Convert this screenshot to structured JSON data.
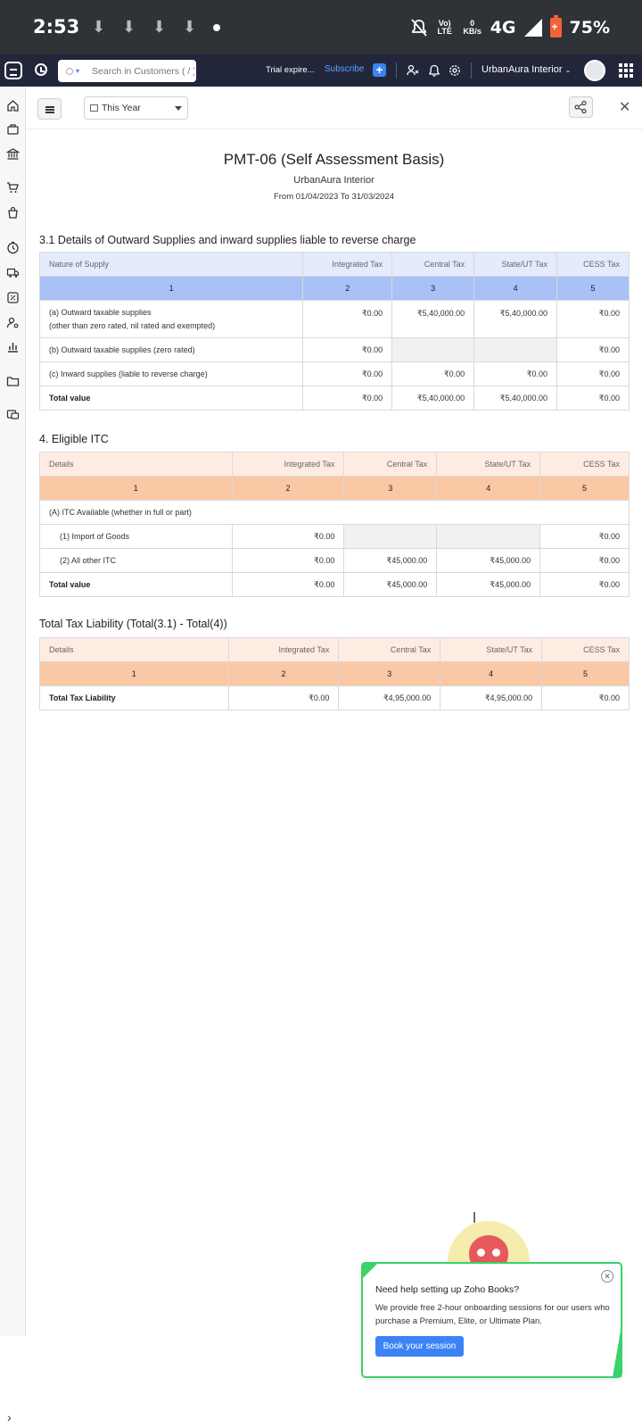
{
  "status_bar": {
    "time": "2:53",
    "network": "4G",
    "volte": "Vo) LTE",
    "speed": "0 KB/s",
    "battery": "75%"
  },
  "app_bar": {
    "search_placeholder": "Search in Customers ( / )",
    "trial_text": "Trial expire...",
    "subscribe_label": "Subscribe",
    "org_name": "UrbanAura Interior"
  },
  "toolbar": {
    "period_label": "This Year"
  },
  "report": {
    "title": "PMT-06 (Self Assessment Basis)",
    "org": "UrbanAura Interior",
    "date_range": "From 01/04/2023 To 31/03/2024"
  },
  "section_31": {
    "heading": "3.1 Details of Outward Supplies and inward supplies liable to reverse charge",
    "columns": [
      "Nature of Supply",
      "Integrated Tax",
      "Central Tax",
      "State/UT Tax",
      "CESS Tax"
    ],
    "index": [
      "1",
      "2",
      "3",
      "4",
      "5"
    ],
    "rows": [
      {
        "label": "(a) Outward taxable supplies",
        "label2": "(other than zero rated, nil rated and exempted)",
        "values": [
          "₹0.00",
          "₹5,40,000.00",
          "₹5,40,000.00",
          "₹0.00"
        ]
      },
      {
        "label": "(b) Outward taxable supplies (zero rated)",
        "values": [
          "₹0.00",
          "",
          "",
          "₹0.00"
        ]
      },
      {
        "label": "(c) Inward supplies (liable to reverse charge)",
        "values": [
          "₹0.00",
          "₹0.00",
          "₹0.00",
          "₹0.00"
        ]
      },
      {
        "label": "Total value",
        "values": [
          "₹0.00",
          "₹5,40,000.00",
          "₹5,40,000.00",
          "₹0.00"
        ]
      }
    ]
  },
  "section_4": {
    "heading": "4. Eligible ITC",
    "columns": [
      "Details",
      "Integrated Tax",
      "Central Tax",
      "State/UT Tax",
      "CESS Tax"
    ],
    "index": [
      "1",
      "2",
      "3",
      "4",
      "5"
    ],
    "group_label": "(A) ITC Available (whether in full or part)",
    "rows": [
      {
        "label": "(1) Import of Goods",
        "values": [
          "₹0.00",
          "",
          "",
          "₹0.00"
        ]
      },
      {
        "label": "(2) All other ITC",
        "values": [
          "₹0.00",
          "₹45,000.00",
          "₹45,000.00",
          "₹0.00"
        ]
      },
      {
        "label": "Total value",
        "values": [
          "₹0.00",
          "₹45,000.00",
          "₹45,000.00",
          "₹0.00"
        ]
      }
    ]
  },
  "section_total": {
    "heading": "Total Tax Liability (Total(3.1) - Total(4))",
    "columns": [
      "Details",
      "Integrated Tax",
      "Central Tax",
      "State/UT Tax",
      "CESS Tax"
    ],
    "index": [
      "1",
      "2",
      "3",
      "4",
      "5"
    ],
    "rows": [
      {
        "label": "Total Tax Liability",
        "values": [
          "₹0.00",
          "₹4,95,000.00",
          "₹4,95,000.00",
          "₹0.00"
        ]
      }
    ]
  },
  "help_popup": {
    "title": "Need help setting up Zoho Books?",
    "body": "We provide free 2-hour onboarding sessions for our users who purchase a Premium, Elite, or Ultimate Plan.",
    "button_label": "Book your session"
  },
  "colors": {
    "appbar": "#22263b",
    "accent": "#3c83f5",
    "blue_header": "#e3ebfd",
    "blue_index": "#a9c1f6",
    "peach_header": "#feece2",
    "peach_index": "#fac8a4",
    "popup_border": "#3ad26a"
  }
}
